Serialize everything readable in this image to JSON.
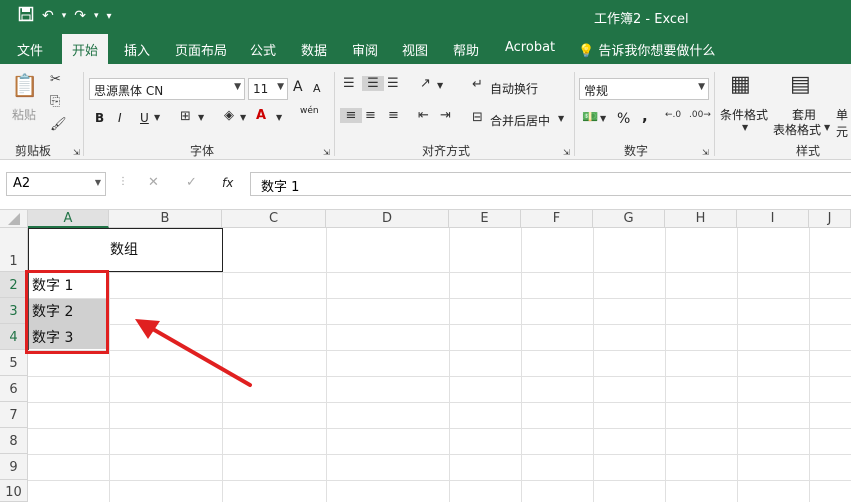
{
  "titlebar": {
    "doc_title": "工作簿2  -  Excel"
  },
  "tabs": [
    "文件",
    "开始",
    "插入",
    "页面布局",
    "公式",
    "数据",
    "审阅",
    "视图",
    "帮助",
    "Acrobat"
  ],
  "active_tab": "开始",
  "tell_me": "告诉我你想要做什么",
  "ribbon": {
    "clipboard": {
      "paste": "粘贴",
      "label": "剪贴板"
    },
    "font": {
      "name": "思源黑体 CN",
      "size": "11",
      "label": "字体",
      "bold": "B",
      "italic": "I",
      "underline": "U",
      "grow": "A",
      "shrink": "A",
      "pinyin": "wén"
    },
    "alignment": {
      "wrap": "自动换行",
      "merge": "合并后居中",
      "label": "对齐方式"
    },
    "number": {
      "format": "常规",
      "label": "数字",
      "percent": "%",
      "comma": ","
    },
    "styles": {
      "cond": "条件格式",
      "table_1": "套用",
      "table_2": "表格格式",
      "cell": "单元",
      "label": "样式"
    }
  },
  "formula_bar": {
    "name_box": "A2",
    "fx": "fx",
    "content": "数字 1"
  },
  "columns": [
    "A",
    "B",
    "C",
    "D",
    "E",
    "F",
    "G",
    "H",
    "I",
    "J"
  ],
  "rows": [
    "1",
    "2",
    "3",
    "4",
    "5",
    "6",
    "7",
    "8",
    "9",
    "10"
  ],
  "cells": {
    "b1": "数组",
    "a2": "数字 1",
    "a3": "数字 2",
    "a4": "数字 3"
  },
  "colors": {
    "accent": "#217346",
    "highlight": "#e02020"
  }
}
